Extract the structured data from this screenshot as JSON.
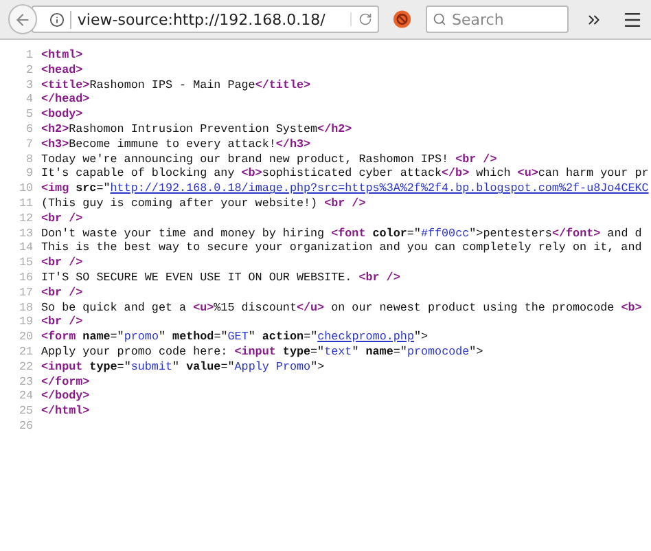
{
  "toolbar": {
    "address": "view-source:http://192.168.0.18/",
    "search": {
      "placeholder": "Search"
    }
  },
  "source_lines": [
    {
      "number": "1",
      "tokens": [
        {
          "kind": "tag",
          "text": "<html>"
        }
      ]
    },
    {
      "number": "2",
      "tokens": [
        {
          "kind": "tag",
          "text": "<head>"
        }
      ]
    },
    {
      "number": "3",
      "tokens": [
        {
          "kind": "tag",
          "text": "<title>"
        },
        {
          "kind": "text",
          "text": "Rashomon IPS - Main Page"
        },
        {
          "kind": "tag",
          "text": "</title>"
        }
      ]
    },
    {
      "number": "4",
      "tokens": [
        {
          "kind": "tag",
          "text": "</head>"
        }
      ]
    },
    {
      "number": "5",
      "tokens": [
        {
          "kind": "tag",
          "text": "<body>"
        }
      ]
    },
    {
      "number": "6",
      "tokens": [
        {
          "kind": "tag",
          "text": "<h2>"
        },
        {
          "kind": "text",
          "text": "Rashomon Intrusion Prevention System"
        },
        {
          "kind": "tag",
          "text": "</h2>"
        }
      ]
    },
    {
      "number": "7",
      "tokens": [
        {
          "kind": "tag",
          "text": "<h3>"
        },
        {
          "kind": "text",
          "text": "Become immune to every attack!"
        },
        {
          "kind": "tag",
          "text": "</h3>"
        }
      ]
    },
    {
      "number": "8",
      "tokens": [
        {
          "kind": "text",
          "text": "Today we're announcing our brand new product, Rashomon IPS! "
        },
        {
          "kind": "tag",
          "text": "<br />"
        }
      ]
    },
    {
      "number": "9",
      "tokens": [
        {
          "kind": "text",
          "text": "It's capable of blocking any "
        },
        {
          "kind": "tag",
          "text": "<b>"
        },
        {
          "kind": "text",
          "text": "sophisticated cyber attack"
        },
        {
          "kind": "tag",
          "text": "</b>"
        },
        {
          "kind": "text",
          "text": " which "
        },
        {
          "kind": "tag",
          "text": "<u>"
        },
        {
          "kind": "text",
          "text": "can harm your pr"
        }
      ]
    },
    {
      "number": "10",
      "tokens": [
        {
          "kind": "tag",
          "text": "<img"
        },
        {
          "kind": "attr",
          "text": " src"
        },
        {
          "kind": "text",
          "text": "=\""
        },
        {
          "kind": "link",
          "text": "http://192.168.0.18/image.php?src=https%3A%2f%2f4.bp.blogspot.com%2f-u8Jo4CEKC"
        }
      ]
    },
    {
      "number": "11",
      "tokens": [
        {
          "kind": "text",
          "text": "(This guy is coming after your website!) "
        },
        {
          "kind": "tag",
          "text": "<br />"
        }
      ]
    },
    {
      "number": "12",
      "tokens": [
        {
          "kind": "tag",
          "text": "<br />"
        }
      ]
    },
    {
      "number": "13",
      "tokens": [
        {
          "kind": "text",
          "text": "Don't waste your time and money by hiring "
        },
        {
          "kind": "tag",
          "text": "<font"
        },
        {
          "kind": "attr",
          "text": " color"
        },
        {
          "kind": "text",
          "text": "=\""
        },
        {
          "kind": "value",
          "text": "#ff00cc"
        },
        {
          "kind": "text",
          "text": "\">"
        },
        {
          "kind": "text",
          "text": "pentesters"
        },
        {
          "kind": "tag",
          "text": "</font>"
        },
        {
          "kind": "text",
          "text": " and d"
        }
      ]
    },
    {
      "number": "14",
      "tokens": [
        {
          "kind": "text",
          "text": "This is the best way to secure your organization and you can completely rely on it, and"
        }
      ]
    },
    {
      "number": "15",
      "tokens": [
        {
          "kind": "tag",
          "text": "<br />"
        }
      ]
    },
    {
      "number": "16",
      "tokens": [
        {
          "kind": "text",
          "text": "IT'S SO SECURE WE EVEN USE IT ON OUR WEBSITE. "
        },
        {
          "kind": "tag",
          "text": "<br />"
        }
      ]
    },
    {
      "number": "17",
      "tokens": [
        {
          "kind": "tag",
          "text": "<br />"
        }
      ]
    },
    {
      "number": "18",
      "tokens": [
        {
          "kind": "text",
          "text": "So be quick and get a "
        },
        {
          "kind": "tag",
          "text": "<u>"
        },
        {
          "kind": "text",
          "text": "%15 discount"
        },
        {
          "kind": "tag",
          "text": "</u>"
        },
        {
          "kind": "text",
          "text": " on our newest product using the promocode "
        },
        {
          "kind": "tag",
          "text": "<b>"
        }
      ]
    },
    {
      "number": "19",
      "tokens": [
        {
          "kind": "tag",
          "text": "<br />"
        }
      ]
    },
    {
      "number": "20",
      "tokens": [
        {
          "kind": "tag",
          "text": "<form"
        },
        {
          "kind": "attr",
          "text": " name"
        },
        {
          "kind": "text",
          "text": "=\""
        },
        {
          "kind": "value",
          "text": "promo"
        },
        {
          "kind": "text",
          "text": "\""
        },
        {
          "kind": "attr",
          "text": " method"
        },
        {
          "kind": "text",
          "text": "=\""
        },
        {
          "kind": "value",
          "text": "GET"
        },
        {
          "kind": "text",
          "text": "\""
        },
        {
          "kind": "attr",
          "text": " action"
        },
        {
          "kind": "text",
          "text": "=\""
        },
        {
          "kind": "link",
          "text": "checkpromo.php"
        },
        {
          "kind": "text",
          "text": "\">"
        }
      ]
    },
    {
      "number": "21",
      "tokens": [
        {
          "kind": "text",
          "text": "Apply your promo code here: "
        },
        {
          "kind": "tag",
          "text": "<input"
        },
        {
          "kind": "attr",
          "text": " type"
        },
        {
          "kind": "text",
          "text": "=\""
        },
        {
          "kind": "value",
          "text": "text"
        },
        {
          "kind": "text",
          "text": "\""
        },
        {
          "kind": "attr",
          "text": " name"
        },
        {
          "kind": "text",
          "text": "=\""
        },
        {
          "kind": "value",
          "text": "promocode"
        },
        {
          "kind": "text",
          "text": "\">"
        }
      ]
    },
    {
      "number": "22",
      "tokens": [
        {
          "kind": "tag",
          "text": "<input"
        },
        {
          "kind": "attr",
          "text": " type"
        },
        {
          "kind": "text",
          "text": "=\""
        },
        {
          "kind": "value",
          "text": "submit"
        },
        {
          "kind": "text",
          "text": "\""
        },
        {
          "kind": "attr",
          "text": " value"
        },
        {
          "kind": "text",
          "text": "=\""
        },
        {
          "kind": "value",
          "text": "Apply Promo"
        },
        {
          "kind": "text",
          "text": "\">"
        }
      ]
    },
    {
      "number": "23",
      "tokens": [
        {
          "kind": "tag",
          "text": "</form>"
        }
      ]
    },
    {
      "number": "24",
      "tokens": [
        {
          "kind": "tag",
          "text": "</body>"
        }
      ]
    },
    {
      "number": "25",
      "tokens": [
        {
          "kind": "tag",
          "text": "</html>"
        }
      ]
    },
    {
      "number": "26"
    }
  ]
}
